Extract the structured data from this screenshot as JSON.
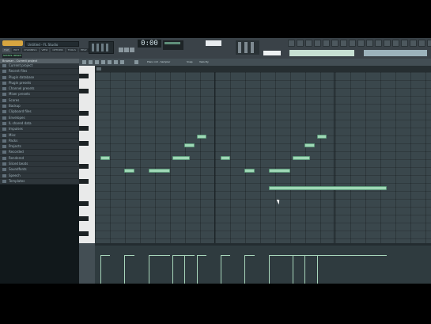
{
  "app": {
    "title_field": "Untitled - FL Studio"
  },
  "toolbar": {
    "menu": [
      "FILE",
      "EDIT",
      "CHANNELS",
      "VIEW",
      "OPTIONS",
      "TOOLS",
      "HELP"
    ],
    "time": "0:00",
    "status": "STATUS: READY",
    "pattern_label": "",
    "hint_text": ""
  },
  "browser": {
    "header": "Browser - Current project",
    "items": [
      "Current project",
      "Recent files",
      "Plugin database",
      "Plugin presets",
      "Channel presets",
      "Mixer presets",
      "Scores",
      "Backup",
      "Clipboard files",
      "Envelopes",
      "IL shared data",
      "Impulses",
      "Misc",
      "Packs",
      "Projects",
      "Recorded",
      "Rendered",
      "Sliced beats",
      "Soundfonts",
      "Speech",
      "Templates"
    ]
  },
  "piano_roll": {
    "title": "Piano roll - Sampler",
    "snap_label": "Snap",
    "tool_label": "Velocity",
    "notes": [
      {
        "key": 67,
        "start": 0.0,
        "length": 0.5
      },
      {
        "key": 64,
        "start": 1.0,
        "length": 0.5
      },
      {
        "key": 64,
        "start": 2.0,
        "length": 1.0
      },
      {
        "key": 67,
        "start": 3.0,
        "length": 0.8
      },
      {
        "key": 70,
        "start": 3.5,
        "length": 0.5
      },
      {
        "key": 72,
        "start": 4.0,
        "length": 0.5
      },
      {
        "key": 67,
        "start": 5.0,
        "length": 0.5
      },
      {
        "key": 64,
        "start": 6.0,
        "length": 0.5
      },
      {
        "key": 64,
        "start": 7.0,
        "length": 1.0
      },
      {
        "key": 67,
        "start": 8.0,
        "length": 0.8
      },
      {
        "key": 70,
        "start": 8.5,
        "length": 0.5
      },
      {
        "key": 72,
        "start": 9.0,
        "length": 0.5
      },
      {
        "key": 60,
        "start": 7.0,
        "length": 5.0
      }
    ]
  }
}
